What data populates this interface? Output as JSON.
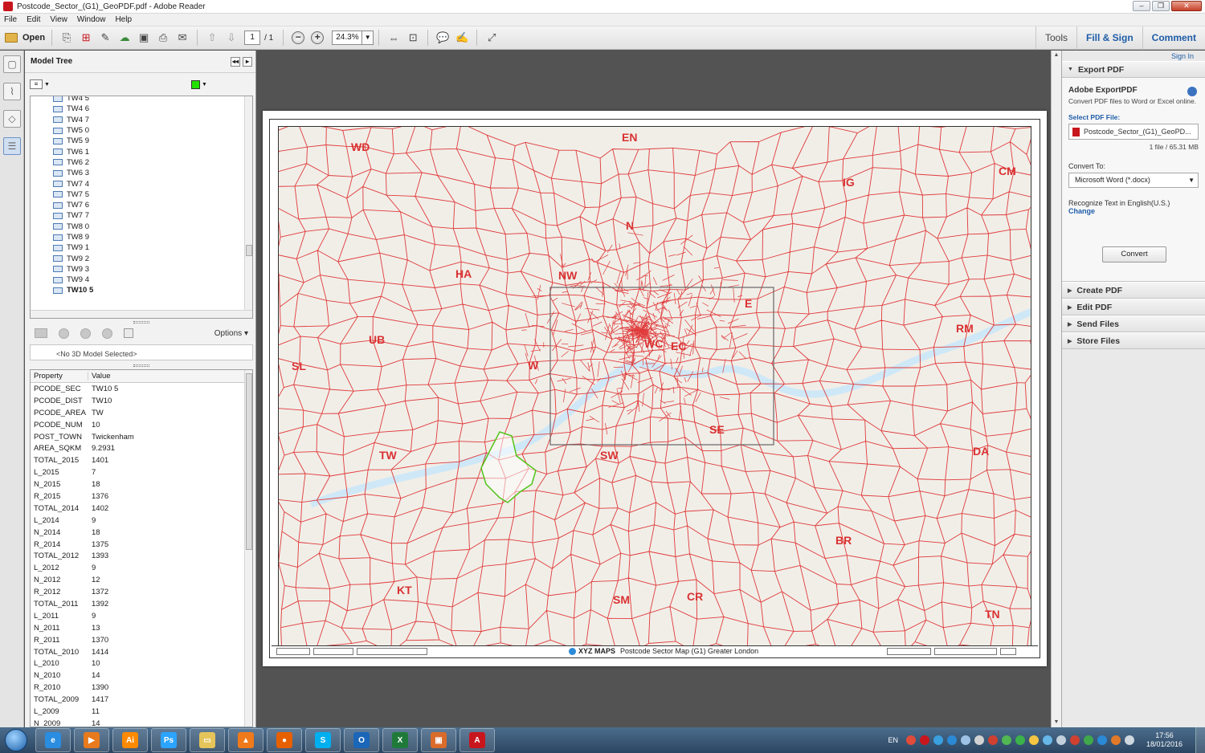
{
  "window": {
    "title": "Postcode_Sector_(G1)_GeoPDF.pdf - Adobe Reader",
    "controls": [
      "–",
      "❐",
      "✕"
    ]
  },
  "menu": [
    "File",
    "Edit",
    "View",
    "Window",
    "Help"
  ],
  "toolbar": {
    "open_label": "Open",
    "page_current": "1",
    "page_total": "/ 1",
    "zoom": "24.3%",
    "tools_label": "Tools",
    "fill_sign_label": "Fill & Sign",
    "comment_label": "Comment"
  },
  "model_panel": {
    "title": "Model Tree",
    "tree_items": [
      "TW4 5",
      "TW4 6",
      "TW4 7",
      "TW5 0",
      "TW5 9",
      "TW6 1",
      "TW6 2",
      "TW6 3",
      "TW7 4",
      "TW7 5",
      "TW7 6",
      "TW7 7",
      "TW8 0",
      "TW8 9",
      "TW9 1",
      "TW9 2",
      "TW9 3",
      "TW9 4",
      "TW10 5"
    ],
    "selected_item": "TW10 5",
    "options_label": "Options",
    "no_model_text": "<No 3D Model Selected>",
    "prop_header": {
      "property": "Property",
      "value": "Value"
    },
    "properties": [
      [
        "PCODE_SEC",
        "TW10 5"
      ],
      [
        "PCODE_DIST",
        "TW10"
      ],
      [
        "PCODE_AREA",
        "TW"
      ],
      [
        "PCODE_NUM",
        "10"
      ],
      [
        "POST_TOWN",
        "Twickenham"
      ],
      [
        "AREA_SQKM",
        "9.2931"
      ],
      [
        "TOTAL_2015",
        "1401"
      ],
      [
        "L_2015",
        "7"
      ],
      [
        "N_2015",
        "18"
      ],
      [
        "R_2015",
        "1376"
      ],
      [
        "TOTAL_2014",
        "1402"
      ],
      [
        "L_2014",
        "9"
      ],
      [
        "N_2014",
        "18"
      ],
      [
        "R_2014",
        "1375"
      ],
      [
        "TOTAL_2012",
        "1393"
      ],
      [
        "L_2012",
        "9"
      ],
      [
        "N_2012",
        "12"
      ],
      [
        "R_2012",
        "1372"
      ],
      [
        "TOTAL_2011",
        "1392"
      ],
      [
        "L_2011",
        "9"
      ],
      [
        "N_2011",
        "13"
      ],
      [
        "R_2011",
        "1370"
      ],
      [
        "TOTAL_2010",
        "1414"
      ],
      [
        "L_2010",
        "10"
      ],
      [
        "N_2010",
        "14"
      ],
      [
        "R_2010",
        "1390"
      ],
      [
        "TOTAL_2009",
        "1417"
      ],
      [
        "L_2009",
        "11"
      ],
      [
        "N_2009",
        "14"
      ]
    ]
  },
  "map": {
    "area_labels": [
      "WD",
      "EN",
      "IG",
      "CM",
      "N",
      "HA",
      "NW",
      "E",
      "UB",
      "WC",
      "EC",
      "RM",
      "SL",
      "W",
      "SE",
      "TW",
      "SW",
      "DA",
      "BR",
      "KT",
      "SM",
      "CR",
      "TN"
    ],
    "footer_brand": "XYZ MAPS",
    "footer_title": "Postcode Sector Map  (G1)  Greater London",
    "colors": {
      "boundary": "#e03a3a",
      "water": "#cfe8f7",
      "land": "#f1eee8",
      "highlight": "#52c41a"
    }
  },
  "right_pane": {
    "sign_in": "Sign In",
    "export_pdf": "Export PDF",
    "adobe_exportpdf": "Adobe ExportPDF",
    "desc": "Convert PDF files to Word or Excel online.",
    "select_label": "Select PDF File:",
    "file_name": "Postcode_Sector_(G1)_GeoPD...",
    "file_size": "1 file / 65.31 MB",
    "convert_to": "Convert To:",
    "convert_option": "Microsoft Word (*.docx)",
    "recognize": "Recognize Text in English(U.S.)",
    "change": "Change",
    "convert_btn": "Convert",
    "sections": [
      "Create PDF",
      "Edit PDF",
      "Send Files",
      "Store Files"
    ]
  },
  "taskbar": {
    "apps": [
      {
        "name": "internet-explorer",
        "glyph": "e",
        "color": "#2a8de0"
      },
      {
        "name": "media-player",
        "glyph": "▶",
        "color": "#e87a1e"
      },
      {
        "name": "illustrator",
        "glyph": "Ai",
        "color": "#ff8a00"
      },
      {
        "name": "photoshop",
        "glyph": "Ps",
        "color": "#2ba4ff"
      },
      {
        "name": "file-explorer",
        "glyph": "▭",
        "color": "#e5c45a"
      },
      {
        "name": "avast",
        "glyph": "▲",
        "color": "#f07a1a"
      },
      {
        "name": "firefox",
        "glyph": "●",
        "color": "#e66000"
      },
      {
        "name": "skype",
        "glyph": "S",
        "color": "#00aff0"
      },
      {
        "name": "outlook",
        "glyph": "O",
        "color": "#1a66b8"
      },
      {
        "name": "excel",
        "glyph": "X",
        "color": "#1f7a3a"
      },
      {
        "name": "powerpoint-or-notes",
        "glyph": "▣",
        "color": "#d96b2b"
      },
      {
        "name": "adobe-reader",
        "glyph": "A",
        "color": "#c8161d"
      }
    ],
    "lang": "EN",
    "time": "17:56",
    "date": "18/01/2016"
  }
}
